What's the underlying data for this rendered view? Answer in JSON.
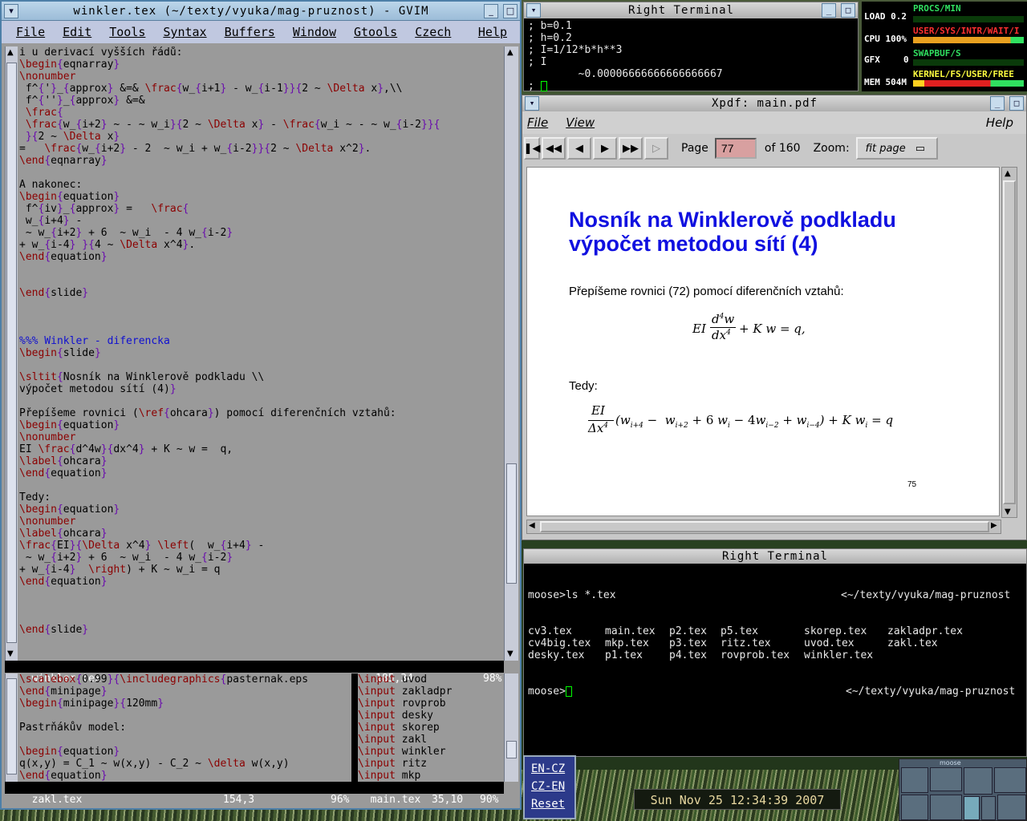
{
  "gvim": {
    "title": "winkler.tex (~/texty/vyuka/mag-pruznost) - GVIM",
    "menu": [
      "File",
      "Edit",
      "Tools",
      "Syntax",
      "Buffers",
      "Window",
      "Gtools",
      "Czech",
      "Help"
    ],
    "top_lines": [
      "i u derivací vyšších řádů:",
      "\\begin{eqnarray}",
      "\\nonumber",
      " f^{'}_{approx} &=& \\frac{w_{i+1} - w_{i-1}}{2 ~ \\Delta x},\\\\",
      " f^{''}_{approx} &=&",
      " \\frac{",
      " \\frac{w_{i+2} ~ - ~ w_i}{2 ~ \\Delta x} - \\frac{w_i ~ - ~ w_{i-2}}{",
      " }{2 ~ \\Delta x}",
      "=   \\frac{w_{i+2} - 2  ~ w_i + w_{i-2}}{2 ~ \\Delta x^2}.",
      "\\end{eqnarray}",
      "",
      "A nakonec:",
      "\\begin{equation}",
      " f^{iv}_{approx} =   \\frac{",
      " w_{i+4} -",
      " ~ w_{i+2} + 6  ~ w_i  - 4 w_{i-2}",
      "+ w_{i-4} }{4 ~ \\Delta x^4}.",
      "\\end{equation}",
      "",
      "",
      "\\end{slide}",
      "",
      "",
      "",
      "%%% Winkler - diferencka",
      "\\begin{slide}",
      "",
      "\\sltit{Nosník na Winklerově podkladu \\\\",
      "výpočet metodou sítí (4)}",
      "",
      "Přepíšeme rovnici (\\ref{ohcara}) pomocí diferenčních vztahů:",
      "\\begin{equation}",
      "\\nonumber",
      "EI \\frac{d^4w}{dx^4} + K ~ w =  q,",
      "\\label{ohcara}",
      "\\end{equation}",
      "",
      "Tedy:",
      "\\begin{equation}",
      "\\nonumber",
      "\\label{ohcara}",
      "\\frac{EI}{\\Delta x^4} \\left(  w_{i+4} -",
      " ~ w_{i+2} + 6  ~ w_i  - 4 w_{i-2}",
      "+ w_{i-4}  \\right) + K ~ w_i = q",
      "\\end{equation}",
      "",
      "",
      "",
      "\\end{slide}"
    ],
    "status_top": {
      "file": "winkler.tex",
      "pos": "185,34",
      "pct": "98%"
    },
    "left_lines": [
      "\\scalebox{0.99}{\\includegraphics{pasternak.eps",
      "\\end{minipage}",
      "\\begin{minipage}{120mm}",
      "",
      "Pastrňákův model:",
      "",
      "\\begin{equation}",
      "q(x,y) = C_1 ~ w(x,y) - C_2 ~ \\delta w(x,y)",
      "\\end{equation}"
    ],
    "right_lines": [
      "\\input uvod",
      "\\input zakladpr",
      "\\input rovprob",
      "\\input desky",
      "\\input skorep",
      "\\input zakl",
      "\\input winkler",
      "\\input ritz",
      "\\input mkp"
    ],
    "status_left": {
      "file": "zakl.tex",
      "pos": "154,3",
      "pct": "96%"
    },
    "status_right": {
      "file": "main.tex",
      "pos": "35,10",
      "pct": "90%"
    }
  },
  "terminal1": {
    "title": "Right Terminal",
    "lines": [
      "; b=0.1",
      "; h=0.2",
      "; I=1/12*b*h**3",
      "; I",
      "        ~0.00006666666666666667",
      "; "
    ]
  },
  "monitor": {
    "load": "LOAD 0.2",
    "cpu": "CPU 100%",
    "gfx": "GFX",
    "gfx_val": "0",
    "mem": "MEM 504M",
    "procs": "PROCS/MIN",
    "user": "USER/SYS/INTR/WAIT/I",
    "swap": "SWAPBUF/S",
    "kernel": "KERNEL/FS/USER/FREE"
  },
  "xpdf": {
    "title": "Xpdf: main.pdf",
    "menu_file": "File",
    "menu_view": "View",
    "menu_help": "Help",
    "page_label": "Page",
    "page_value": "77",
    "of_pages": "of 160",
    "zoom_label": "Zoom:",
    "zoom_value": "fit page",
    "slide_title1": "Nosník na Winklerově podkladu",
    "slide_title2": "výpočet metodou sítí (4)",
    "para1": "Přepíšeme rovnici (72) pomocí diferenčních vztahů:",
    "para2": "Tedy:",
    "page_number": "75"
  },
  "terminal2": {
    "title": "Right Terminal",
    "prompt": "moose>ls *.tex",
    "path": "<~/texty/vyuka/mag-pruznost",
    "files": [
      [
        "cv3.tex",
        "main.tex",
        "p2.tex",
        "p5.tex",
        "skorep.tex",
        "zakladpr.tex"
      ],
      [
        "cv4big.tex",
        "mkp.tex",
        "p3.tex",
        "ritz.tex",
        "uvod.tex",
        "zakl.tex"
      ],
      [
        "desky.tex",
        "p1.tex",
        "p4.tex",
        "rovprob.tex",
        "winkler.tex",
        ""
      ]
    ],
    "prompt2": "moose>",
    "path2": "<~/texty/vyuka/mag-pruznost"
  },
  "keyboard": [
    "EN-CZ",
    "CZ-EN",
    "Reset"
  ],
  "clock": "Sun Nov 25 12:34:39 2007",
  "pager": {
    "title": "moose"
  }
}
